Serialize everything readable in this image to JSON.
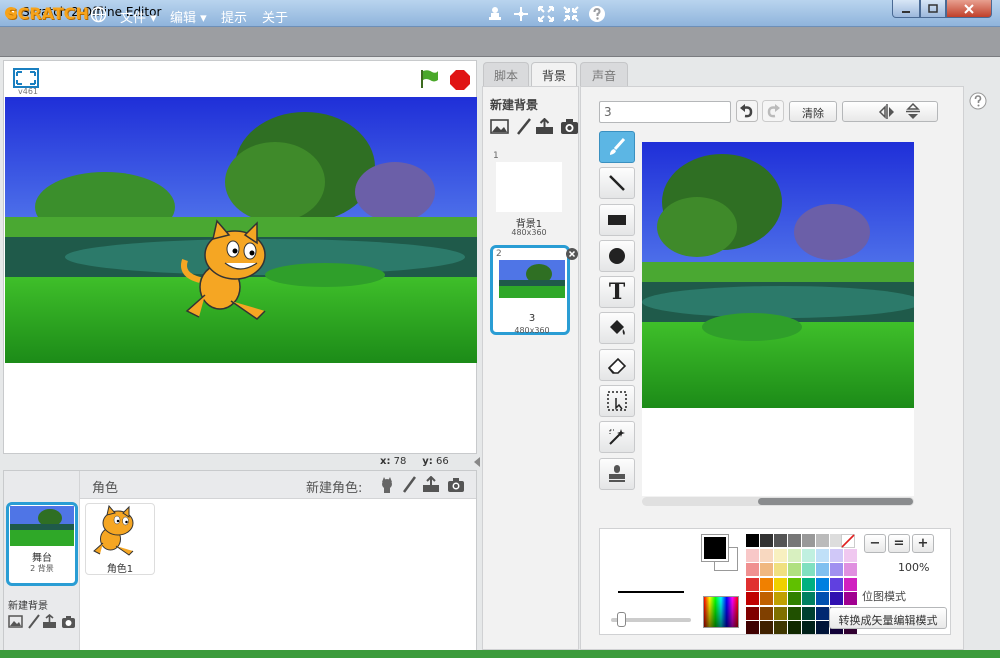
{
  "window": {
    "title": "Scratch 2 Offline Editor"
  },
  "menubar": {
    "logo": "SCRATCH",
    "menus": [
      "文件 ▾",
      "编辑 ▾",
      "提示",
      "关于"
    ]
  },
  "stage": {
    "version": "v461",
    "coords": {
      "x_label": "x:",
      "x_value": "78",
      "y_label": "y:",
      "y_value": "66"
    }
  },
  "sprites": {
    "header_label": "角色",
    "new_sprite_label": "新建角色:",
    "stage_thumb": {
      "name": "舞台",
      "sub": "2 背景"
    },
    "items": [
      {
        "name": "角色1"
      }
    ],
    "new_backdrop_label": "新建背景"
  },
  "tabs": [
    {
      "label": "脚本",
      "active": false
    },
    {
      "label": "背景",
      "active": true
    },
    {
      "label": "声音",
      "active": false
    }
  ],
  "backdrops": {
    "title": "新建背景",
    "items": [
      {
        "index": "1",
        "name": "背景1",
        "size": "480x360",
        "selected": false
      },
      {
        "index": "2",
        "name": "3",
        "size": "480x360",
        "selected": true
      }
    ]
  },
  "editor": {
    "name_value": "3",
    "clear_label": "清除",
    "zoom_level": "100%",
    "mode_label": "位图模式",
    "convert_label": "转换成矢量编辑模式",
    "tools": [
      "brush-tool",
      "line-tool",
      "rectangle-tool",
      "ellipse-tool",
      "text-tool",
      "fill-tool",
      "eraser-tool",
      "select-tool",
      "magic-select-tool",
      "stamp-tool"
    ],
    "text_tool_glyph": "T",
    "zoom_glyphs": [
      "−",
      "=",
      "+"
    ],
    "primary_color": "#000000",
    "secondary_color": "#ffffff",
    "swatches": [
      "#000000",
      "#333333",
      "#555555",
      "#777777",
      "#999999",
      "#bbbbbb",
      "#dddddd",
      "#ffffff",
      "#f8c8c8",
      "#f8d8c0",
      "#f8f0c0",
      "#d8f0c0",
      "#c0f0e0",
      "#c0e0f8",
      "#d0c8f8",
      "#f0c8f0",
      "#f09090",
      "#f0b880",
      "#f0e080",
      "#b0e080",
      "#80e0c0",
      "#80c0f0",
      "#a090f0",
      "#e090e0",
      "#e03030",
      "#f08000",
      "#f0d000",
      "#60c000",
      "#00b080",
      "#0080e0",
      "#6040e0",
      "#d020c0",
      "#c00000",
      "#c06000",
      "#c0a000",
      "#308000",
      "#008060",
      "#0050b0",
      "#3010b0",
      "#a00090",
      "#800000",
      "#804000",
      "#807000",
      "#205000",
      "#004030",
      "#002870",
      "#200070",
      "#600060",
      "#400000",
      "#402000",
      "#403800",
      "#102800",
      "#002018",
      "#001438",
      "#100038",
      "#300030"
    ]
  }
}
